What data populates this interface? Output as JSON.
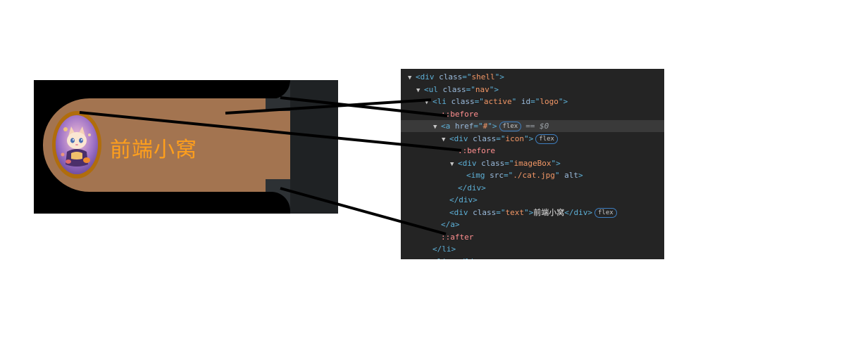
{
  "preview": {
    "brand_text": "前端小窝",
    "logo_alt": "cat avatar"
  },
  "devtools": {
    "lines": [
      {
        "indent": 0,
        "caret": "▼",
        "parts": [
          [
            "tag",
            "<div "
          ],
          [
            "attr",
            "class"
          ],
          [
            "tag",
            "=\""
          ],
          [
            "val",
            "shell"
          ],
          [
            "tag",
            "\">"
          ]
        ]
      },
      {
        "indent": 1,
        "caret": "▼",
        "parts": [
          [
            "tag",
            "<ul "
          ],
          [
            "attr",
            "class"
          ],
          [
            "tag",
            "=\""
          ],
          [
            "val",
            "nav"
          ],
          [
            "tag",
            "\">"
          ]
        ]
      },
      {
        "indent": 2,
        "caret": "▼",
        "parts": [
          [
            "tag",
            "<li "
          ],
          [
            "attr",
            "class"
          ],
          [
            "tag",
            "=\""
          ],
          [
            "val",
            "active"
          ],
          [
            "tag",
            "\" "
          ],
          [
            "attr",
            "id"
          ],
          [
            "tag",
            "=\""
          ],
          [
            "val",
            "logo"
          ],
          [
            "tag",
            "\">"
          ]
        ]
      },
      {
        "indent": 3,
        "caret": "",
        "parts": [
          [
            "pseudo",
            "::before"
          ]
        ]
      },
      {
        "indent": 3,
        "caret": "▼",
        "parts": [
          [
            "tag",
            "<a "
          ],
          [
            "attr",
            "href"
          ],
          [
            "tag",
            "=\""
          ],
          [
            "val",
            "#"
          ],
          [
            "tag",
            "\">"
          ]
        ],
        "badge": "flex",
        "suffix": "== $0",
        "selected": true
      },
      {
        "indent": 4,
        "caret": "▼",
        "parts": [
          [
            "tag",
            "<div "
          ],
          [
            "attr",
            "class"
          ],
          [
            "tag",
            "=\""
          ],
          [
            "val",
            "icon"
          ],
          [
            "tag",
            "\">"
          ]
        ],
        "badge": "flex"
      },
      {
        "indent": 5,
        "caret": "",
        "parts": [
          [
            "pseudo",
            "::before"
          ]
        ]
      },
      {
        "indent": 5,
        "caret": "▼",
        "parts": [
          [
            "tag",
            "<div "
          ],
          [
            "attr",
            "class"
          ],
          [
            "tag",
            "=\""
          ],
          [
            "val",
            "imageBox"
          ],
          [
            "tag",
            "\">"
          ]
        ]
      },
      {
        "indent": 6,
        "caret": "",
        "parts": [
          [
            "tag",
            "<img "
          ],
          [
            "attr",
            "src"
          ],
          [
            "tag",
            "=\""
          ],
          [
            "val",
            "./cat.jpg"
          ],
          [
            "tag",
            "\" "
          ],
          [
            "attr",
            "alt"
          ],
          [
            "tag",
            ">"
          ]
        ]
      },
      {
        "indent": 5,
        "caret": "",
        "parts": [
          [
            "tag",
            "</div>"
          ]
        ]
      },
      {
        "indent": 4,
        "caret": "",
        "parts": [
          [
            "tag",
            "</div>"
          ]
        ]
      },
      {
        "indent": 4,
        "caret": "",
        "parts": [
          [
            "tag",
            "<div "
          ],
          [
            "attr",
            "class"
          ],
          [
            "tag",
            "=\""
          ],
          [
            "val",
            "text"
          ],
          [
            "tag",
            "\">"
          ],
          [
            "txt",
            "前端小窝"
          ],
          [
            "tag",
            "</div>"
          ]
        ],
        "badge": "flex"
      },
      {
        "indent": 3,
        "caret": "",
        "parts": [
          [
            "tag",
            "</a>"
          ]
        ]
      },
      {
        "indent": 3,
        "caret": "",
        "parts": [
          [
            "pseudo",
            "::after"
          ]
        ]
      },
      {
        "indent": 2,
        "caret": "",
        "parts": [
          [
            "tag",
            "</li>"
          ]
        ]
      },
      {
        "indent": 2,
        "caret": "▶",
        "parts": [
          [
            "tag",
            "<li>"
          ],
          [
            "muted",
            "…"
          ],
          [
            "tag",
            "</li>"
          ]
        ]
      }
    ]
  },
  "colors": {
    "pill": "#a37450",
    "brand_text": "#ff9f1c",
    "ring": "#b06d0c",
    "devtools_bg": "#242424"
  },
  "icons": {
    "expand_caret": "▼",
    "collapsed_caret": "▶"
  }
}
